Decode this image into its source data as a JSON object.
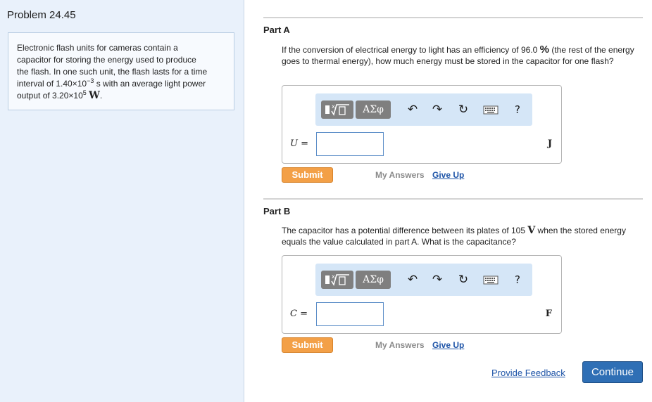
{
  "problem": {
    "title": "Problem 24.45",
    "text": {
      "line1": "Electronic flash units for cameras contain a",
      "line2": "capacitor for storing the energy used to produce",
      "line3": "the flash. In one such unit, the flash lasts for a time",
      "line4_pre": "interval of 1.40×10",
      "line4_exp": "−3",
      "line4_unit": "s",
      "line4_post": "with an average light power",
      "line5_pre": "output of 3.20×10",
      "line5_exp": "5",
      "line5_unit": "W",
      "line5_post": "."
    }
  },
  "toolbar": {
    "template_icon": "sqrt-template-icon",
    "greek_label": "ΑΣφ",
    "undo_glyph": "↶",
    "redo_glyph": "↷",
    "reset_glyph": "↻",
    "help_glyph": "?"
  },
  "partA": {
    "label": "Part A",
    "question_pre": "If the conversion of electrical energy to light has an efficiency of 96.0 ",
    "question_symbol": "%",
    "question_post": " (the rest of the energy goes to thermal energy), how much energy must be stored in the capacitor for one flash?",
    "variable": "U =",
    "unit": "J",
    "input_value": "",
    "submit_label": "Submit",
    "my_answers_label": "My Answers",
    "give_up_label": "Give Up"
  },
  "partB": {
    "label": "Part B",
    "question_pre": "The capacitor has a potential difference between its plates of 105 ",
    "question_symbol": "V",
    "question_post": " when the stored energy equals the value calculated in part A. What is the capacitance?",
    "variable": "C =",
    "unit": "F",
    "input_value": "",
    "submit_label": "Submit",
    "my_answers_label": "My Answers",
    "give_up_label": "Give Up"
  },
  "footer": {
    "feedback_label": "Provide Feedback",
    "continue_label": "Continue"
  },
  "colors": {
    "left_pane_bg": "#e9f1fb",
    "toolbar_bg": "#d5e6f7",
    "submit_orange": "#f3a047",
    "continue_blue": "#2f6fb5",
    "link_blue": "#1f55a8"
  }
}
